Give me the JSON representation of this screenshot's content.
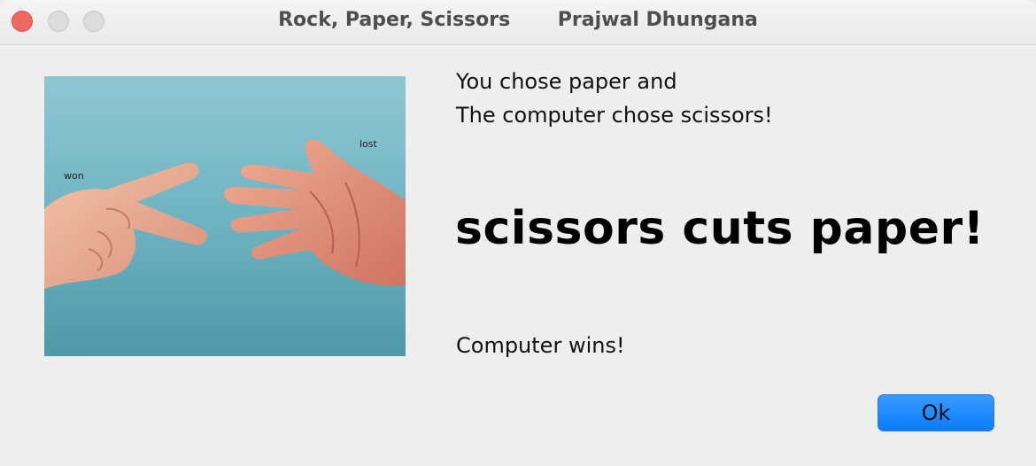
{
  "window": {
    "title": "Rock, Paper, Scissors       Prajwal Dhungana"
  },
  "image": {
    "description_icon": "hands-rock-paper-scissors-photo",
    "label_left": "won",
    "label_right": "lost",
    "background_color": "#5ea9b8"
  },
  "message": {
    "line1": "You chose paper and",
    "line2": "The computer chose scissors!"
  },
  "headline": "scissors cuts paper!",
  "result": "Computer wins!",
  "buttons": {
    "ok_label": "Ok"
  },
  "colors": {
    "accent": "#0a7cff",
    "close": "#ee6a5f"
  }
}
